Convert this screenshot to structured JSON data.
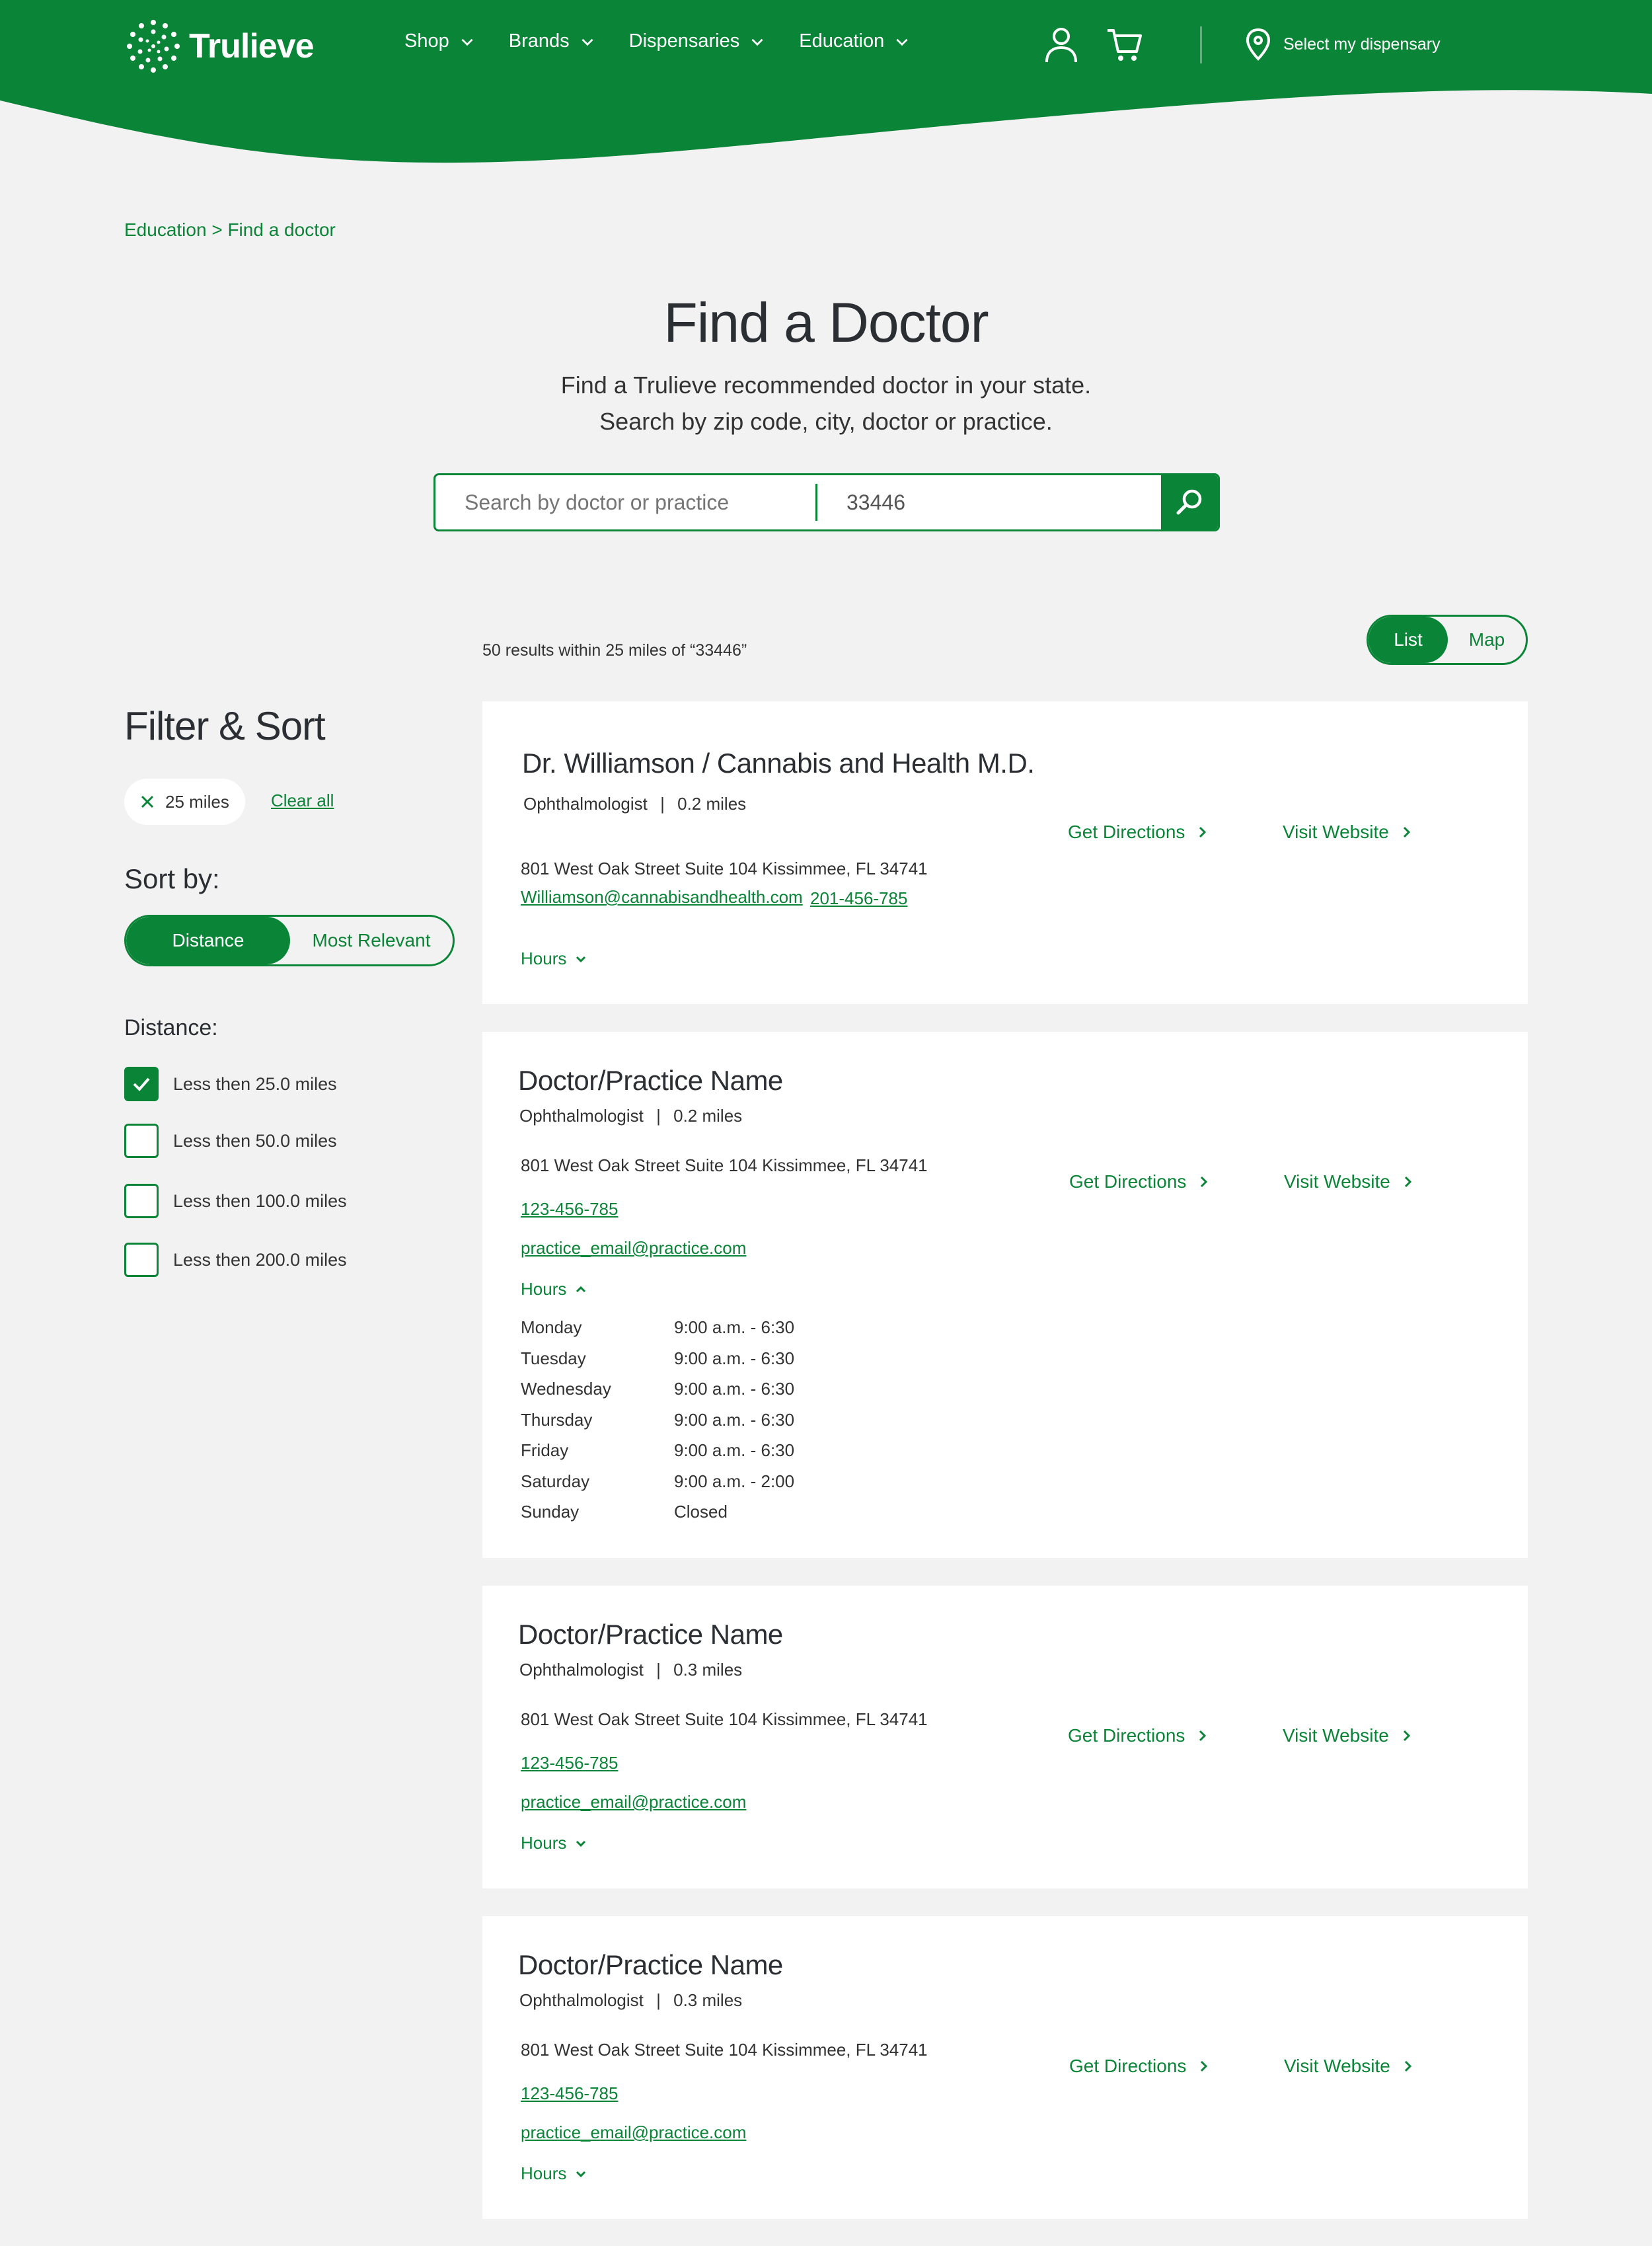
{
  "header": {
    "logo_text": "Trulieve",
    "nav": [
      {
        "label": "Shop"
      },
      {
        "label": "Brands"
      },
      {
        "label": "Dispensaries"
      },
      {
        "label": "Education"
      }
    ],
    "dispensary_label": "Select my dispensary",
    "brand_color": "#0a8437"
  },
  "breadcrumb": "Education > Find a doctor",
  "hero": {
    "title": "Find a Doctor",
    "subtitle_line1": "Find a Trulieve recommended doctor in your state.",
    "subtitle_line2": "Search by zip code, city, doctor or practice."
  },
  "search": {
    "doctor_placeholder": "Search by doctor or practice",
    "zip_value": "33446"
  },
  "results_text": "50 results within 25 miles of “33446”",
  "view_toggle": {
    "list": "List",
    "map": "Map",
    "active": "List"
  },
  "sidebar": {
    "title": "Filter & Sort",
    "chip_label": "25 miles",
    "clear_all": "Clear all",
    "sort_label": "Sort by:",
    "sort_options": [
      "Distance",
      "Most Relevant"
    ],
    "sort_active": "Distance",
    "distance_label": "Distance:",
    "distance_options": [
      {
        "label": "Less then 25.0 miles",
        "checked": true
      },
      {
        "label": "Less then 50.0 miles",
        "checked": false
      },
      {
        "label": "Less then 100.0 miles",
        "checked": false
      },
      {
        "label": "Less then 200.0 miles",
        "checked": false
      }
    ]
  },
  "results": [
    {
      "name": "Dr. Williamson / Cannabis and Health M.D.",
      "specialty": "Ophthalmologist",
      "distance": "0.2 miles",
      "address": "801 West Oak Street Suite 104 Kissimmee, FL 34741",
      "email": "Williamson@cannabisandhealth.com",
      "phone": "201-456-785",
      "hours_label": "Hours",
      "directions": "Get Directions",
      "website": "Visit Website"
    },
    {
      "name": "Doctor/Practice Name",
      "specialty": "Ophthalmologist",
      "distance": "0.2 miles",
      "address": "801 West Oak Street Suite 104 Kissimmee, FL 34741",
      "phone": "123-456-785",
      "email": "practice_email@practice.com",
      "hours_label": "Hours",
      "directions": "Get Directions",
      "website": "Visit Website",
      "hours": [
        {
          "day": "Monday",
          "time": "9:00 a.m. - 6:30"
        },
        {
          "day": "Tuesday",
          "time": "9:00 a.m. - 6:30"
        },
        {
          "day": "Wednesday",
          "time": "9:00 a.m. - 6:30"
        },
        {
          "day": "Thursday",
          "time": "9:00 a.m. - 6:30"
        },
        {
          "day": "Friday",
          "time": "9:00 a.m. - 6:30"
        },
        {
          "day": "Saturday",
          "time": "9:00 a.m. - 2:00"
        },
        {
          "day": "Sunday",
          "time": "Closed"
        }
      ]
    },
    {
      "name": "Doctor/Practice Name",
      "specialty": "Ophthalmologist",
      "distance": "0.3 miles",
      "address": "801 West Oak Street Suite 104 Kissimmee, FL 34741",
      "phone": "123-456-785",
      "email": "practice_email@practice.com",
      "hours_label": "Hours",
      "directions": "Get Directions",
      "website": "Visit Website"
    },
    {
      "name": "Doctor/Practice Name",
      "specialty": "Ophthalmologist",
      "distance": "0.3 miles",
      "address": "801 West Oak Street Suite 104 Kissimmee, FL 34741",
      "phone": "123-456-785",
      "email": "practice_email@practice.com",
      "hours_label": "Hours",
      "directions": "Get Directions",
      "website": "Visit Website"
    }
  ]
}
